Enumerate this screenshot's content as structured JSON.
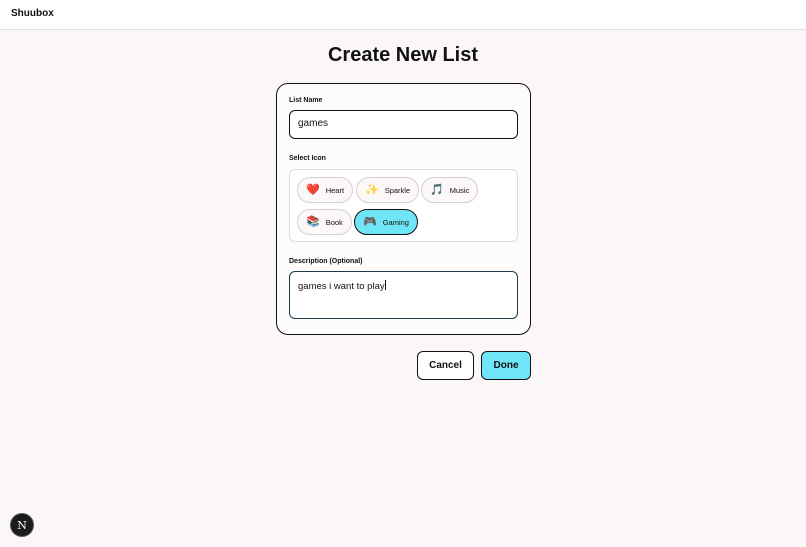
{
  "app": {
    "brand": "Shuubox"
  },
  "page": {
    "title": "Create New List"
  },
  "form": {
    "list_name_label": "List Name",
    "list_name_value": "games",
    "select_icon_label": "Select Icon",
    "icons": [
      {
        "emoji": "❤️",
        "label": "Heart",
        "icon": "heart-icon",
        "selected": false
      },
      {
        "emoji": "✨",
        "label": "Sparkle",
        "icon": "sparkle-icon",
        "selected": false
      },
      {
        "emoji": "🎵",
        "label": "Music",
        "icon": "music-icon",
        "selected": false
      },
      {
        "emoji": "📚",
        "label": "Book",
        "icon": "book-icon",
        "selected": false
      },
      {
        "emoji": "🎮",
        "label": "Gaming",
        "icon": "gaming-icon",
        "selected": true
      }
    ],
    "description_label": "Description (Optional)",
    "description_value": "games i want to play"
  },
  "actions": {
    "cancel_label": "Cancel",
    "done_label": "Done"
  },
  "dev_badge": {
    "letter": "N"
  },
  "colors": {
    "accent": "#6fe6f7",
    "background": "#fbf7f6",
    "border": "#111111"
  }
}
